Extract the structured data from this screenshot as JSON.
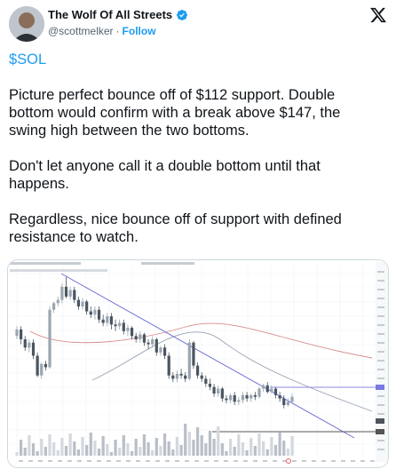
{
  "header": {
    "display_name": "The Wolf Of All Streets",
    "handle": "@scottmelker",
    "separator": "·",
    "follow_label": "Follow"
  },
  "tweet": {
    "cashtag": "$SOL",
    "paragraph_1": "Picture perfect bounce off of $112 support. Double bottom would confirm with a break above $147, the swing high between the two bottoms.",
    "paragraph_2": "Don't let anyone call it a double bottom until that happens.",
    "paragraph_3": "Regardless, nice bounce off of support with defined resistance to watch."
  },
  "colors": {
    "accent": "#1d9bf0",
    "text": "#0f1419",
    "muted": "#536471",
    "up_candle": "#9aa5b1",
    "down_candle": "#4a5560",
    "trendline": "#6f6fd8",
    "resistance": "#8a8ae0",
    "support": "#555555",
    "ma_red": "#d98c8c"
  },
  "icons": {
    "verified": "verified-badge-icon",
    "x_logo": "x-logo-icon"
  },
  "chart_data": {
    "type": "candlestick",
    "title": "",
    "annotations": {
      "support": 112,
      "resistance": 147
    },
    "candle_shape": [
      [
        62,
        66,
        60,
        68
      ],
      [
        66,
        60,
        57,
        68
      ],
      [
        60,
        55,
        53,
        62
      ],
      [
        55,
        58,
        52,
        60
      ],
      [
        58,
        50,
        48,
        60
      ],
      [
        50,
        38,
        37,
        52
      ],
      [
        38,
        45,
        36,
        46
      ],
      [
        45,
        43,
        41,
        47
      ],
      [
        43,
        78,
        42,
        80
      ],
      [
        78,
        82,
        76,
        83
      ],
      [
        82,
        84,
        80,
        86
      ],
      [
        84,
        92,
        82,
        94
      ],
      [
        92,
        86,
        85,
        98
      ],
      [
        86,
        90,
        84,
        92
      ],
      [
        90,
        84,
        82,
        92
      ],
      [
        84,
        80,
        78,
        86
      ],
      [
        80,
        83,
        78,
        85
      ],
      [
        83,
        77,
        75,
        84
      ],
      [
        77,
        75,
        73,
        80
      ],
      [
        75,
        78,
        72,
        80
      ],
      [
        78,
        72,
        70,
        80
      ],
      [
        72,
        70,
        68,
        75
      ],
      [
        70,
        74,
        68,
        76
      ],
      [
        74,
        69,
        66,
        76
      ],
      [
        69,
        68,
        65,
        72
      ],
      [
        68,
        70,
        66,
        72
      ],
      [
        70,
        65,
        63,
        72
      ],
      [
        65,
        67,
        62,
        69
      ],
      [
        67,
        62,
        60,
        68
      ],
      [
        62,
        60,
        58,
        64
      ],
      [
        60,
        63,
        58,
        65
      ],
      [
        63,
        58,
        56,
        64
      ],
      [
        58,
        57,
        54,
        60
      ],
      [
        57,
        60,
        55,
        62
      ],
      [
        60,
        52,
        50,
        61
      ],
      [
        52,
        55,
        50,
        56
      ],
      [
        55,
        50,
        48,
        57
      ],
      [
        50,
        38,
        36,
        52
      ],
      [
        38,
        36,
        34,
        40
      ],
      [
        36,
        39,
        34,
        41
      ],
      [
        39,
        38,
        36,
        42
      ],
      [
        38,
        36,
        34,
        40
      ],
      [
        36,
        58,
        35,
        60
      ],
      [
        58,
        44,
        42,
        59
      ],
      [
        44,
        38,
        36,
        46
      ],
      [
        38,
        36,
        34,
        40
      ],
      [
        36,
        33,
        31,
        38
      ],
      [
        33,
        31,
        29,
        36
      ],
      [
        31,
        27,
        25,
        33
      ],
      [
        27,
        30,
        25,
        32
      ],
      [
        30,
        24,
        22,
        31
      ],
      [
        24,
        23,
        21,
        26
      ],
      [
        23,
        26,
        21,
        27
      ],
      [
        26,
        22,
        20,
        28
      ],
      [
        22,
        23,
        20,
        25
      ],
      [
        23,
        26,
        21,
        28
      ],
      [
        26,
        24,
        22,
        28
      ],
      [
        24,
        26,
        22,
        27
      ],
      [
        26,
        25,
        23,
        28
      ],
      [
        25,
        30,
        24,
        31
      ],
      [
        30,
        32,
        28,
        33
      ],
      [
        32,
        28,
        27,
        34
      ],
      [
        28,
        30,
        27,
        32
      ],
      [
        30,
        26,
        24,
        31
      ],
      [
        26,
        24,
        22,
        28
      ],
      [
        24,
        20,
        18,
        26
      ],
      [
        20,
        22,
        19,
        24
      ],
      [
        22,
        25,
        21,
        27
      ]
    ]
  }
}
